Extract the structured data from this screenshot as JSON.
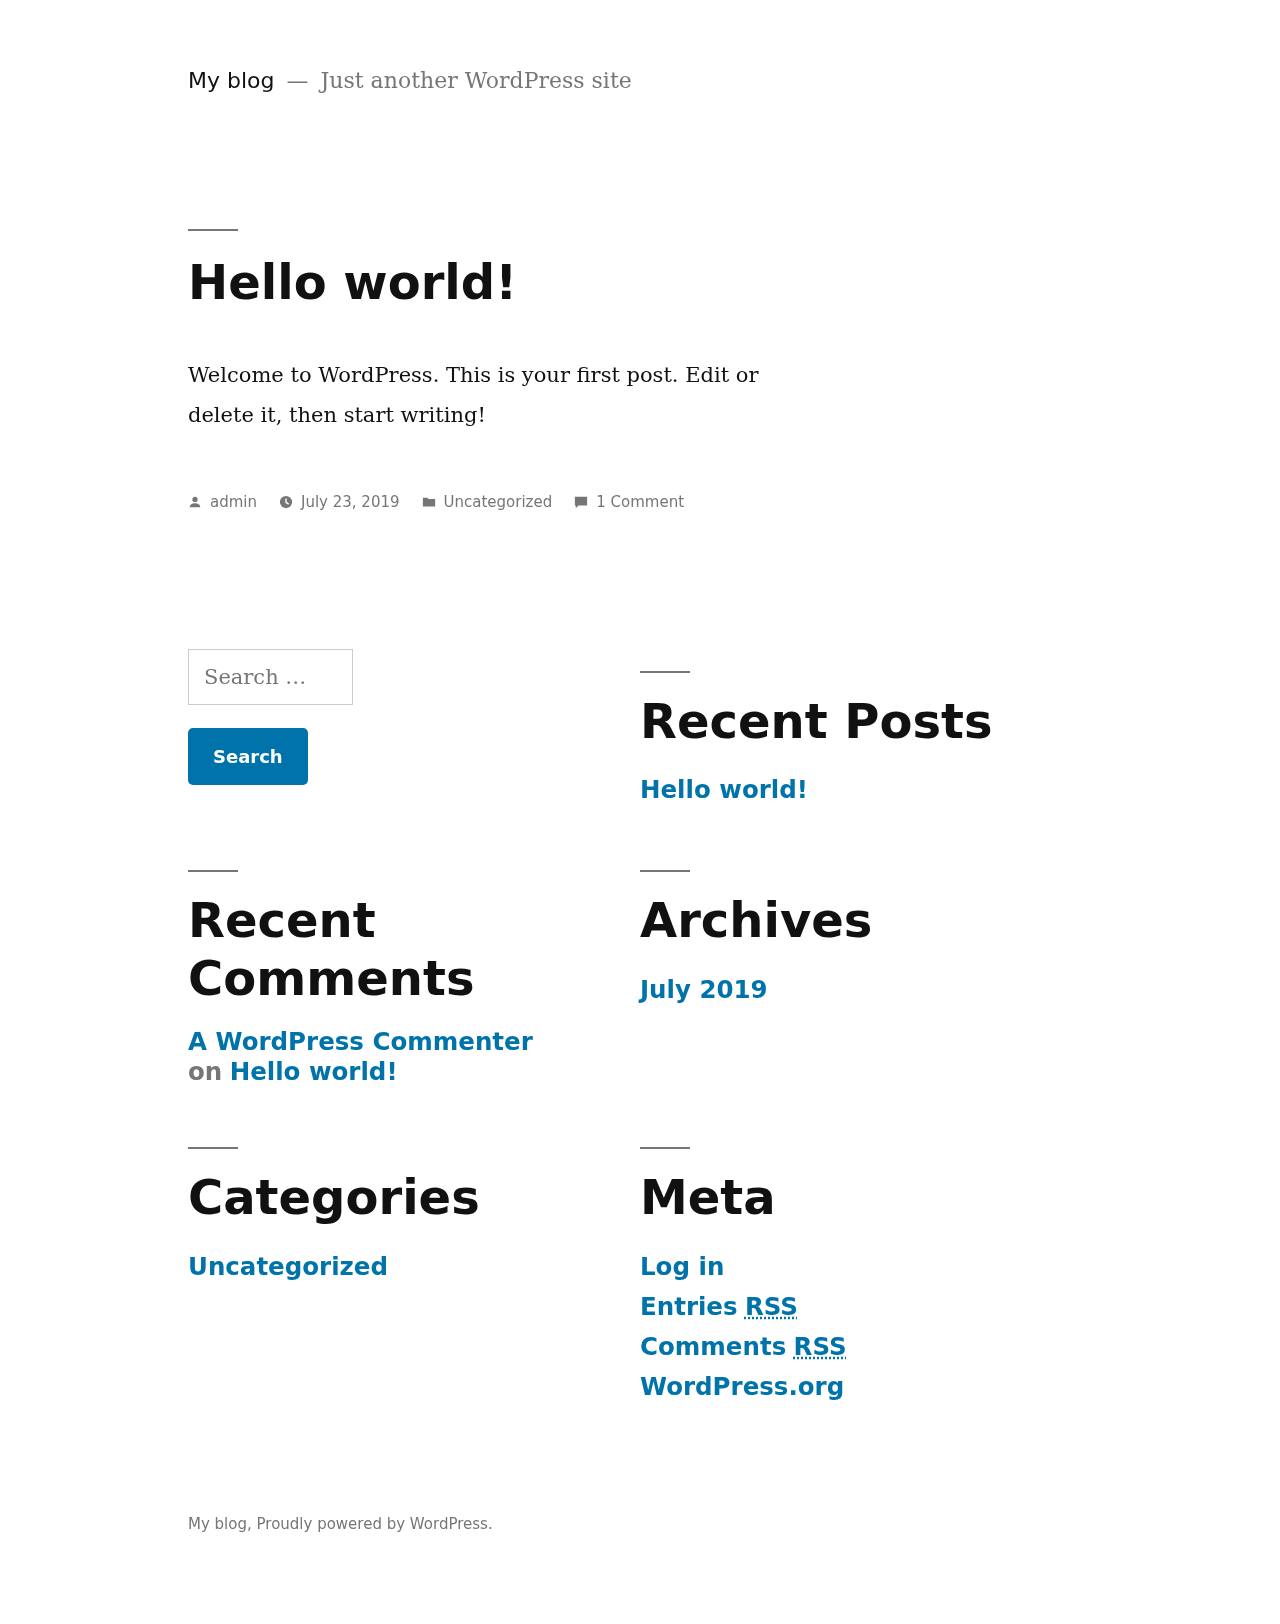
{
  "header": {
    "site_title": "My blog",
    "separator": "—",
    "tagline": "Just another WordPress site"
  },
  "post": {
    "title": "Hello world!",
    "body": "Welcome to WordPress. This is your first post. Edit or delete it, then start writing!",
    "meta": [
      {
        "kind": "author",
        "text": "admin"
      },
      {
        "kind": "date",
        "text": "July 23, 2019"
      },
      {
        "kind": "category",
        "text": "Uncategorized"
      },
      {
        "kind": "comments",
        "text": "1 Comment"
      }
    ]
  },
  "search": {
    "placeholder": "Search …",
    "button": "Search"
  },
  "recent_posts": {
    "title": "Recent Posts",
    "items": [
      "Hello world!"
    ]
  },
  "recent_comments": {
    "title": "Recent Comments",
    "items": [
      {
        "author": "A WordPress Commenter",
        "connector": "on",
        "post": "Hello world!"
      }
    ]
  },
  "archives": {
    "title": "Archives",
    "items": [
      "July 2019"
    ]
  },
  "categories": {
    "title": "Categories",
    "items": [
      "Uncategorized"
    ]
  },
  "meta": {
    "title": "Meta",
    "items": [
      {
        "text": "Log in"
      },
      {
        "text": "Entries",
        "abbr": "RSS"
      },
      {
        "text": "Comments",
        "abbr": "RSS"
      },
      {
        "text": "WordPress.org"
      }
    ]
  },
  "footer": "My blog, Proudly powered by WordPress."
}
